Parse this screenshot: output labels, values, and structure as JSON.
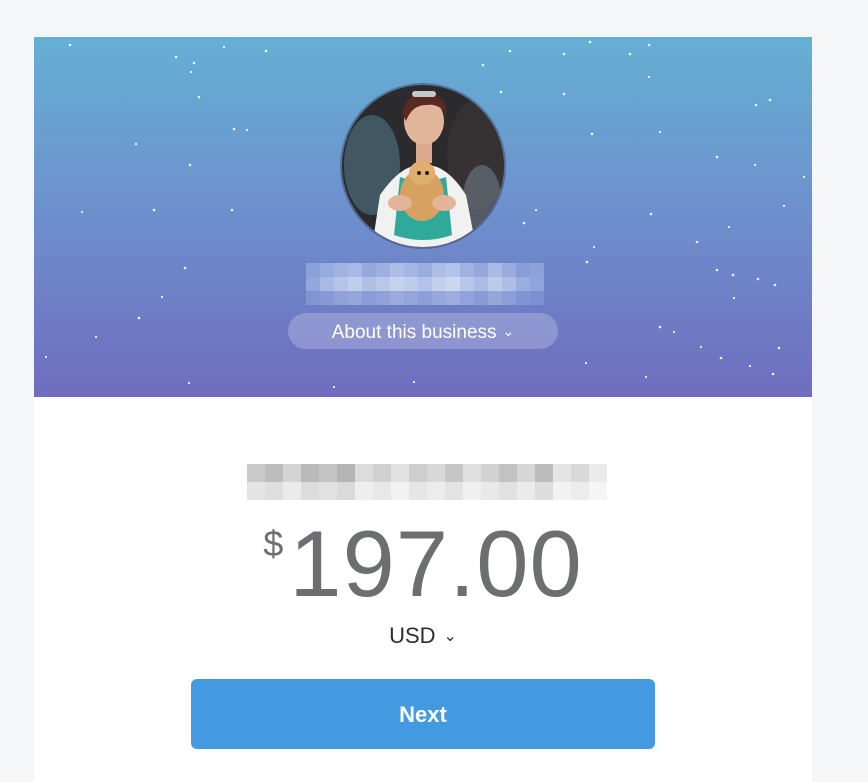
{
  "colors": {
    "gradient_top": "#64b0d4",
    "gradient_bottom": "#6f6dbf",
    "button": "#449ae1",
    "amount_text": "#6d6e71"
  },
  "header": {
    "avatar_alt": "business profile photo",
    "about_label": "About this business",
    "about_icon": "chevron-down-icon"
  },
  "payment": {
    "currency_symbol": "$",
    "amount": "197.00",
    "currency_code": "USD",
    "currency_icon": "chevron-down-icon"
  },
  "actions": {
    "next_label": "Next"
  }
}
